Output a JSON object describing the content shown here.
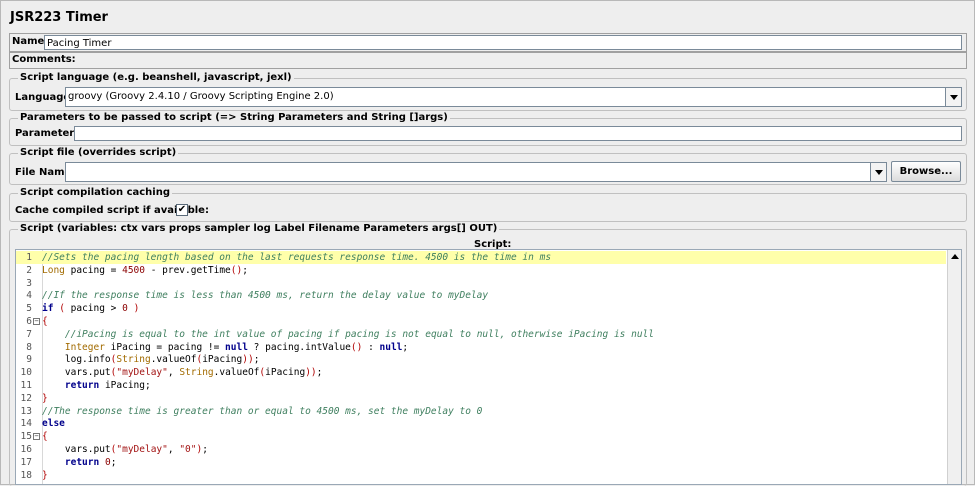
{
  "panel": {
    "title": "JSR223 Timer"
  },
  "name_field": {
    "label": "Name:",
    "value": "Pacing Timer"
  },
  "comments": {
    "label": "Comments:"
  },
  "script_language": {
    "group_title": "Script language (e.g. beanshell, javascript, jexl)",
    "label": "Language:",
    "selected": "groovy     (Groovy 2.4.10 / Groovy Scripting Engine 2.0)"
  },
  "parameters": {
    "group_title": "Parameters to be passed to script (=> String Parameters and String []args)",
    "label": "Parameters:",
    "value": ""
  },
  "script_file": {
    "group_title": "Script file (overrides script)",
    "label": "File Name:",
    "value": "",
    "browse_label": "Browse..."
  },
  "caching": {
    "group_title": "Script compilation caching",
    "label": "Cache compiled script if available:",
    "checked": true,
    "check_glyph": "✔"
  },
  "script": {
    "group_title": "Script (variables: ctx vars props sampler log Label Filename Parameters args[] OUT)",
    "header": "Script:",
    "line_numbers": [
      "1",
      "2",
      "3",
      "4",
      "5",
      "6",
      "7",
      "8",
      "9",
      "10",
      "11",
      "12",
      "13",
      "14",
      "15",
      "16",
      "17",
      "18"
    ],
    "fold_markers": {
      "6": "−",
      "15": "−"
    },
    "lines": [
      [
        [
          "c-comment",
          "//Sets the pacing length based on the last requests response time. 4500 is the time in ms"
        ]
      ],
      [
        [
          "c-type",
          "Long"
        ],
        [
          "c-def",
          " pacing = "
        ],
        [
          "c-num",
          "4500"
        ],
        [
          "c-def",
          " - prev.getTime"
        ],
        [
          "c-brace",
          "()"
        ],
        [
          "c-def",
          ";"
        ]
      ],
      [],
      [
        [
          "c-comment",
          "//If the response time is less than 4500 ms, return the delay value to myDelay"
        ]
      ],
      [
        [
          "c-kw",
          "if"
        ],
        [
          "c-def",
          " "
        ],
        [
          "c-brace",
          "("
        ],
        [
          "c-def",
          " pacing > "
        ],
        [
          "c-num",
          "0"
        ],
        [
          "c-def",
          " "
        ],
        [
          "c-brace",
          ")"
        ]
      ],
      [
        [
          "c-brace",
          "{"
        ]
      ],
      [
        [
          "c-def",
          "    "
        ],
        [
          "c-comment",
          "//iPacing is equal to the int value of pacing if pacing is not equal to null, otherwise iPacing is null"
        ]
      ],
      [
        [
          "c-def",
          "    "
        ],
        [
          "c-type",
          "Integer"
        ],
        [
          "c-def",
          " iPacing = pacing != "
        ],
        [
          "c-kw",
          "null"
        ],
        [
          "c-def",
          " ? pacing.intValue"
        ],
        [
          "c-brace",
          "()"
        ],
        [
          "c-def",
          " : "
        ],
        [
          "c-kw",
          "null"
        ],
        [
          "c-def",
          ";"
        ]
      ],
      [
        [
          "c-def",
          "    log.info"
        ],
        [
          "c-brace",
          "("
        ],
        [
          "c-type",
          "String"
        ],
        [
          "c-def",
          ".valueOf"
        ],
        [
          "c-brace",
          "("
        ],
        [
          "c-def",
          "iPacing"
        ],
        [
          "c-brace",
          "))"
        ],
        [
          "c-def",
          ";"
        ]
      ],
      [
        [
          "c-def",
          "    vars.put"
        ],
        [
          "c-brace",
          "("
        ],
        [
          "c-str",
          "\"myDelay\""
        ],
        [
          "c-def",
          ", "
        ],
        [
          "c-type",
          "String"
        ],
        [
          "c-def",
          ".valueOf"
        ],
        [
          "c-brace",
          "("
        ],
        [
          "c-def",
          "iPacing"
        ],
        [
          "c-brace",
          "))"
        ],
        [
          "c-def",
          ";"
        ]
      ],
      [
        [
          "c-def",
          "    "
        ],
        [
          "c-kw",
          "return"
        ],
        [
          "c-def",
          " iPacing;"
        ]
      ],
      [
        [
          "c-brace",
          "}"
        ]
      ],
      [
        [
          "c-comment",
          "//The response time is greater than or equal to 4500 ms, set the myDelay to 0"
        ]
      ],
      [
        [
          "c-kw",
          "else"
        ]
      ],
      [
        [
          "c-brace",
          "{"
        ]
      ],
      [
        [
          "c-def",
          "    vars.put"
        ],
        [
          "c-brace",
          "("
        ],
        [
          "c-str",
          "\"myDelay\""
        ],
        [
          "c-def",
          ", "
        ],
        [
          "c-str",
          "\"0\""
        ],
        [
          "c-brace",
          ")"
        ],
        [
          "c-def",
          ";"
        ]
      ],
      [
        [
          "c-def",
          "    "
        ],
        [
          "c-kw",
          "return"
        ],
        [
          "c-def",
          " "
        ],
        [
          "c-num",
          "0"
        ],
        [
          "c-def",
          ";"
        ]
      ],
      [
        [
          "c-brace",
          "}"
        ]
      ]
    ]
  },
  "colors": {
    "highlight_line": "#ffffaa",
    "comment": "#3f7f5f",
    "keyword": "#00008b"
  }
}
